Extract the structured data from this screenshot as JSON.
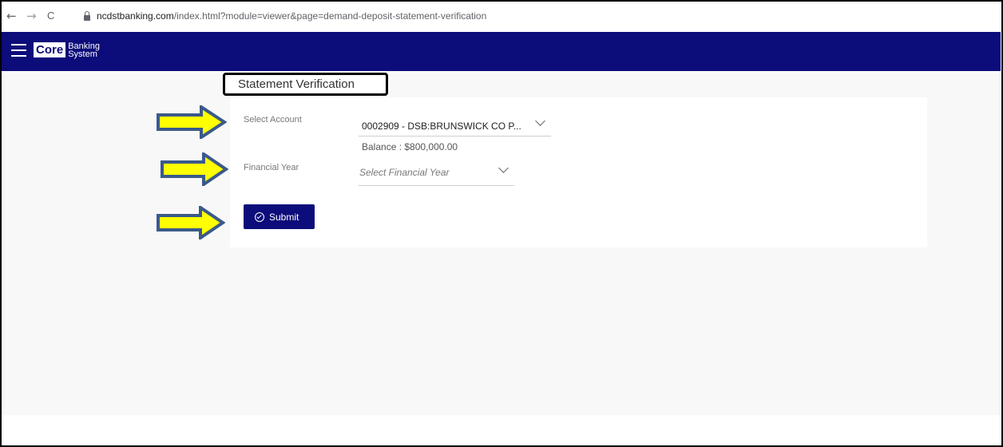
{
  "browser": {
    "back": "←",
    "forward": "→",
    "reload": "C",
    "url_host": "ncdstbanking.com",
    "url_path": "/index.html?module=viewer&page=demand-deposit-statement-verification"
  },
  "app": {
    "logo_core": "Core",
    "logo_line1": "Banking",
    "logo_line2": "System"
  },
  "page": {
    "title": "Statement Verification"
  },
  "form": {
    "account_label": "Select Account",
    "account_value": "0002909 - DSB:BRUNSWICK CO P...",
    "balance": "Balance : $800,000.00",
    "year_label": "Financial Year",
    "year_placeholder": "Select Financial Year",
    "submit_label": "Submit"
  },
  "colors": {
    "header": "#0c0c7a",
    "arrow_fill": "#ffff00",
    "arrow_stroke": "#3b5a8a"
  }
}
